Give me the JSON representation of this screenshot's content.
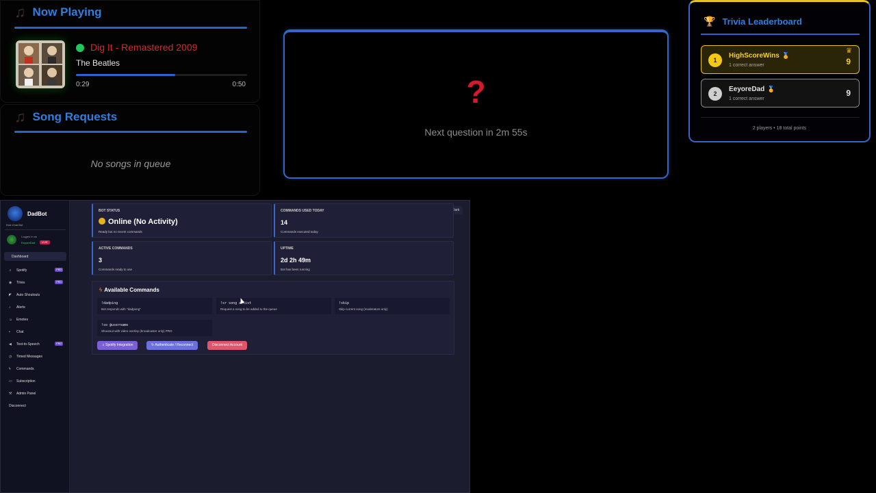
{
  "now_playing": {
    "title": "Now Playing",
    "song": "Dig It - Remastered 2009",
    "artist": "The Beatles",
    "current_time": "0:29",
    "total_time": "0:50",
    "progress": 0.58
  },
  "song_requests": {
    "title": "Song Requests",
    "empty_text": "No songs in queue"
  },
  "trivia": {
    "next_question": "Next question in 2m 55s"
  },
  "leaderboard": {
    "title": "Trivia Leaderboard",
    "players": [
      {
        "rank": "1",
        "name": "HighScoreWins",
        "sub": "1 correct answer",
        "score": "9"
      },
      {
        "rank": "2",
        "name": "EeyoreDad",
        "sub": "1 correct answer",
        "score": "9"
      }
    ],
    "footer": "2 players • 18 total points"
  },
  "dashboard": {
    "brand": {
      "name": "DadBot",
      "sub": "Kick Chat Bot"
    },
    "user": {
      "logged_label": "Logged in as",
      "name": "EeyoreDad",
      "badge": "LIVE"
    },
    "nav": [
      {
        "label": "Dashboard"
      },
      {
        "label": "Spotify",
        "icon": "music-icon",
        "pro": "PRO"
      },
      {
        "label": "Trivia",
        "icon": "brain-icon",
        "pro": "PRO"
      },
      {
        "label": "Auto Shoutouts",
        "icon": "megaphone-icon"
      },
      {
        "label": "Alerts",
        "icon": "bell-icon"
      },
      {
        "label": "Emotes",
        "icon": "smile-icon"
      },
      {
        "label": "Chat",
        "icon": "chat-icon"
      },
      {
        "label": "Text-to-Speech",
        "icon": "speaker-icon",
        "pro": "PRO"
      },
      {
        "label": "Timed Messages",
        "icon": "clock-icon"
      },
      {
        "label": "Commands",
        "icon": "bolt-icon"
      },
      {
        "label": "Subscription",
        "icon": "card-icon"
      },
      {
        "label": "Admin Panel",
        "icon": "wrench-icon"
      },
      {
        "label": "Disconnect"
      }
    ],
    "theme_toggle": "Dark",
    "stats": [
      {
        "label": "BOT STATUS",
        "value": "Online (No Activity)",
        "sub": "Ready but no recent commands"
      },
      {
        "label": "COMMANDS USED TODAY",
        "value": "14",
        "sub": "Commands executed today"
      },
      {
        "label": "ACTIVE COMMANDS",
        "value": "3",
        "sub": "Commands ready to use"
      },
      {
        "label": "UPTIME",
        "value": "2d 2h 49m",
        "sub": "Bot has been running"
      }
    ],
    "commands": {
      "title": "Available Commands",
      "items": [
        {
          "name": "!dadping",
          "desc": "Bot responds with \"dadpong\""
        },
        {
          "name": "!sr song artist",
          "desc": "Request a song to be added to the queue"
        },
        {
          "name": "!skip",
          "desc": "Skip current song (moderators only)"
        },
        {
          "name": "!so @username",
          "desc": "Shoutout with video overlay (broadcaster only) PRO"
        }
      ],
      "buttons": [
        "Spotify Integration",
        "Authenticate / Reconnect",
        "Disconnect Account"
      ]
    }
  }
}
